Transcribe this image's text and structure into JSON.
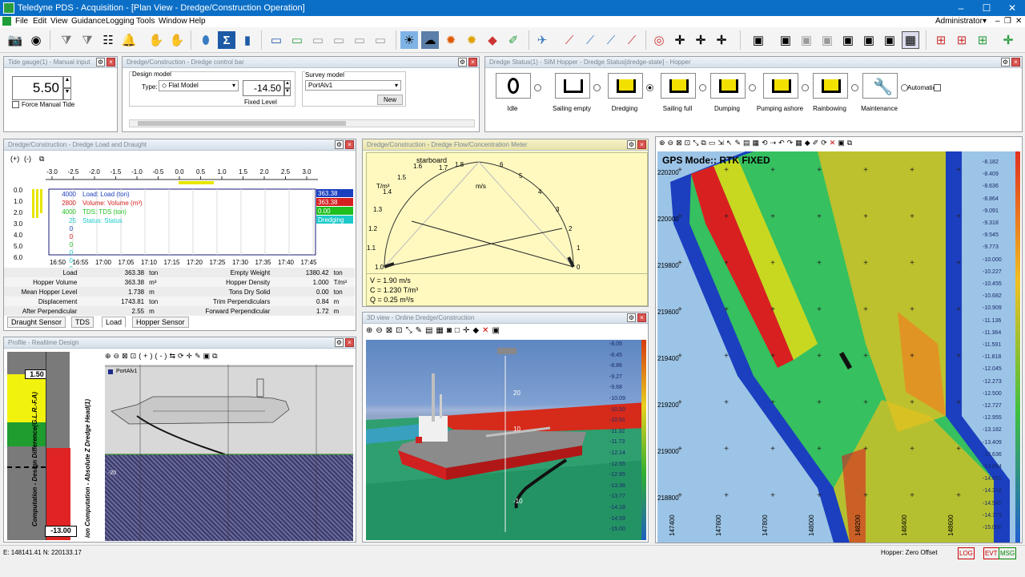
{
  "window": {
    "title": "Teledyne PDS - Acquisition - [Plan View - Dredge/Construction Operation]",
    "minimize": "–",
    "maximize": "☐",
    "close": "✕"
  },
  "menu": [
    "File",
    "Edit",
    "View",
    "Guidance",
    "Logging",
    "Tools",
    "Window",
    "Help"
  ],
  "user": "Administrator",
  "tide_gauge": {
    "title": "Tide gauge(1) - Manual input",
    "value": "5.50",
    "force_label": "Force Manual Tide"
  },
  "dredge_control": {
    "title": "Dredge/Construction - Dredge control bar",
    "design_model_label": "Design model",
    "type_label": "Type:",
    "type_value": "Flat Model",
    "fixed_value": "-14.50",
    "fixed_label": "Fixed Level",
    "survey_model_label": "Survey model",
    "survey_value": "PortAlv1",
    "new_label": "New"
  },
  "dredge_status": {
    "title": "Dredge Status(1) - SIM Hopper - Dredge Status[dredge-state] - Hopper",
    "states": [
      "Idle",
      "Sailing empty",
      "Dredging",
      "Sailing full",
      "Dumping",
      "Pumping ashore",
      "Rainbowing",
      "Maintenance"
    ],
    "automatic_label": "Automatic"
  },
  "load_draught": {
    "title": "Dredge/Construction - Dredge Load and Draught",
    "scale_ticks": [
      "-3.0",
      "-2.5",
      "-2.0",
      "-1.5",
      "-1.0",
      "-0.5",
      "0.0",
      "0.5",
      "1.0",
      "1.5",
      "2.0",
      "2.5",
      "3.0"
    ],
    "y_ticks": [
      "0.0",
      "1.0",
      "2.0",
      "3.0",
      "4.0",
      "5.0",
      "6.0"
    ],
    "legend": [
      {
        "scale": "4000",
        "label": "Load: Load (ton)",
        "color": "#1a3fbf"
      },
      {
        "scale": "2800",
        "label": "Volume: Volume (m³)",
        "color": "#d62020"
      },
      {
        "scale": "4000",
        "label": "TDS: TDS (ton)",
        "color": "#1fbf1f"
      },
      {
        "scale": "25",
        "label": "Status: Status",
        "color": "#1cc9c9"
      }
    ],
    "zeros": [
      "0",
      "0",
      "0",
      "0",
      "0",
      "0"
    ],
    "right_values": [
      {
        "text": "363.38",
        "bg": "#1a3fbf"
      },
      {
        "text": "363.38",
        "bg": "#d62020"
      },
      {
        "text": "0.00",
        "bg": "#1fbf1f"
      },
      {
        "text": "Dredging",
        "bg": "#1cc9c9"
      }
    ],
    "time_ticks": [
      "16:50",
      "16:55",
      "17:00",
      "17:05",
      "17:10",
      "17:15",
      "17:20",
      "17:25",
      "17:30",
      "17:35",
      "17:40",
      "17:45"
    ],
    "rows": [
      [
        "Load",
        "363.38",
        "ton",
        "Empty Weight",
        "1380.42",
        "ton"
      ],
      [
        "Hopper Volume",
        "363.38",
        "m³",
        "Hopper Density",
        "1.000",
        "T/m³"
      ],
      [
        "Mean Hopper Level",
        "1.738",
        "m",
        "Tons Dry Solid",
        "0.00",
        "ton"
      ],
      [
        "Displacement",
        "1743.81",
        "ton",
        "Trim Perpendiculars",
        "0.84",
        "m"
      ],
      [
        "After Perpendicular",
        "2.55",
        "m",
        "Forward Perpendicular",
        "1.72",
        "m"
      ]
    ],
    "tabs": [
      "Draught Sensor",
      "TDS",
      "Load",
      "Hopper Sensor"
    ]
  },
  "flow_meter": {
    "title": "Dredge/Construction - Dredge Flow/Concentration Meter",
    "starboard": "starboard",
    "unit_left": "T/m³",
    "unit_right": "m/s",
    "left_ticks": [
      "1.0",
      "1.1",
      "1.2",
      "1.3",
      "1.4",
      "1.5",
      "1.6"
    ],
    "right_ticks": [
      "0",
      "1",
      "2",
      "3",
      "4",
      "5",
      "6"
    ],
    "top_ticks": [
      "1.8",
      "1.7"
    ],
    "v": "V = 1.90 m/s",
    "c": "C = 1.230 T/m³",
    "q": "Q = 0.25 m³/s"
  },
  "view3d": {
    "title": "3D view - Online Dredge/Construction",
    "scale": [
      "-8.05",
      "-8.45",
      "-8.86",
      "-9.27",
      "-9.68",
      "-10.09",
      "-10.50",
      "-10.91",
      "-11.32",
      "-11.73",
      "-12.14",
      "-12.55",
      "-12.95",
      "-13.36",
      "-13.77",
      "-14.18",
      "-14.59",
      "-15.00"
    ],
    "axis": [
      "20",
      "10",
      "-10"
    ]
  },
  "profile": {
    "title": "Profile - Realtime Design",
    "left_axis": "Computation - Design Difference(G.L.R.-F.A)",
    "top_value": "1.50",
    "bottom_value": "-13.00",
    "mid_axis": "ion Computation - Absolute Z Dredge Head(1)",
    "port_label": "PortAlv1",
    "level": "-20"
  },
  "plan_view": {
    "gps": "GPS Mode:: RTK FIXED",
    "y_ticks": [
      "220200",
      "220000",
      "219800",
      "219600",
      "219400",
      "219200",
      "219000",
      "218800"
    ],
    "x_ticks": [
      "147400",
      "147600",
      "147800",
      "148000",
      "148200",
      "148400",
      "148600"
    ],
    "scale": [
      "-8.182",
      "-8.409",
      "-8.636",
      "-8.864",
      "-9.091",
      "-9.318",
      "-9.545",
      "-9.773",
      "-10.000",
      "-10.227",
      "-10.455",
      "-10.682",
      "-10.909",
      "-11.136",
      "-11.364",
      "-11.591",
      "-11.818",
      "-12.045",
      "-12.273",
      "-12.500",
      "-12.727",
      "-12.955",
      "-13.182",
      "-13.409",
      "-13.636",
      "-13.864",
      "-14.091",
      "-14.318",
      "-14.545",
      "-14.773",
      "-15.000"
    ]
  },
  "status": {
    "coords": "E: 148141.41 N: 220133.17",
    "hopper": "Hopper: Zero Offset",
    "log": "LOG",
    "evt": "EVT",
    "msg": "MSG"
  }
}
